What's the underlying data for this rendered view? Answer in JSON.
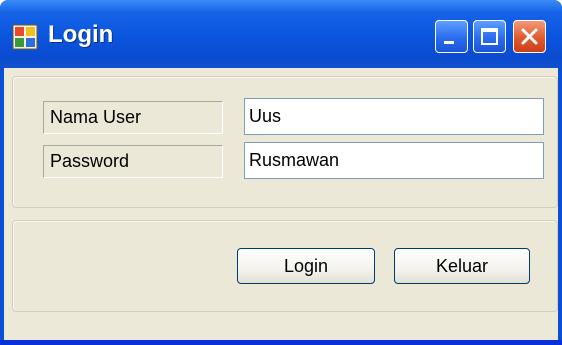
{
  "window": {
    "title": "Login",
    "buttons": {
      "minimize": "minimize",
      "maximize": "maximize",
      "close": "close"
    }
  },
  "form": {
    "username_label": "Nama User",
    "username_value": "Uus",
    "password_label": "Password",
    "password_value": "Rusmawan"
  },
  "actions": {
    "login_label": "Login",
    "exit_label": "Keluar"
  },
  "colors": {
    "titlebar": "#0a55dd",
    "client": "#ece9d8",
    "close_button": "#e15a2e"
  }
}
